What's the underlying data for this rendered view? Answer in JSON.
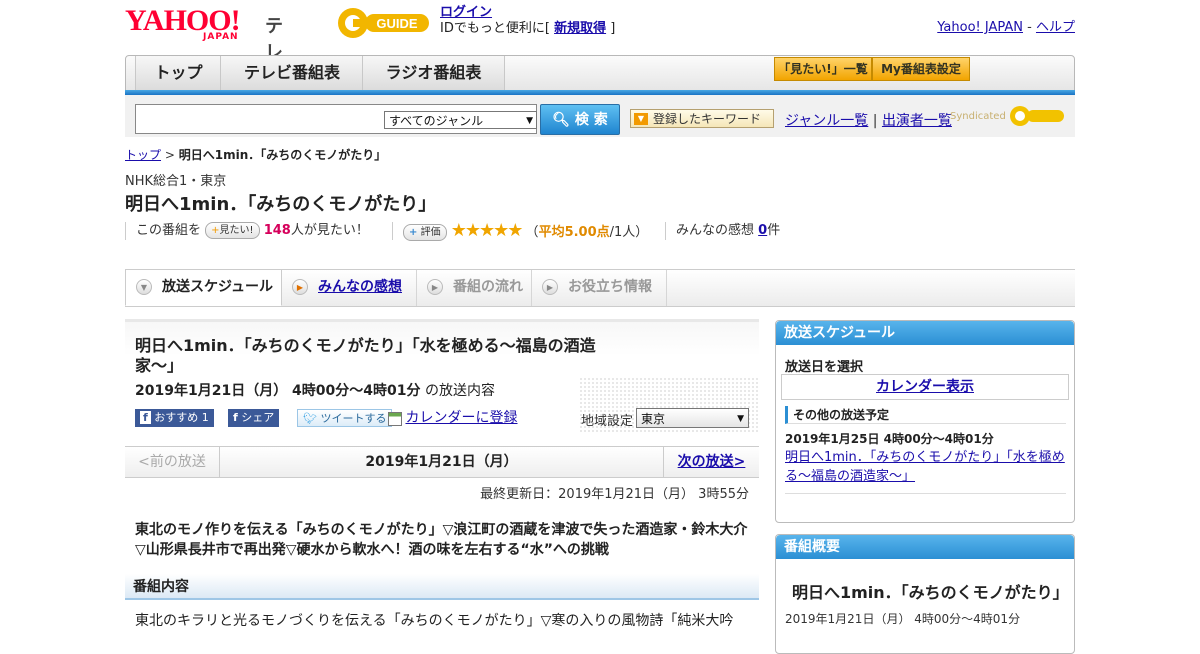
{
  "header": {
    "logo_yahoo": "YAHOO!",
    "logo_japan": "JAPAN",
    "logo_tv": "テレビ",
    "gguide": "G GUIDE",
    "login_link": "ログイン",
    "login_text": "IDでもっと便利に[",
    "signup_link": "新規取得",
    "login_close": "]",
    "yahoo_japan_link": "Yahoo! JAPAN",
    "separator": "-",
    "help_link": "ヘルプ"
  },
  "nav": {
    "tabs": [
      "トップ",
      "テレビ番組表",
      "ラジオ番組表"
    ],
    "mitai_list": "「見たい!」一覧",
    "my_settings": "My番組表設定"
  },
  "search": {
    "genre_selected": "すべてのジャンル",
    "search_button": "検 索",
    "keyword_button": "登録したキーワード",
    "genre_list": "ジャンル一覧",
    "divider": "|",
    "performer_list": "出演者一覧",
    "syndicated": "Syndicated"
  },
  "breadcrumb": {
    "top": "トップ",
    "separator": ">",
    "current": "明日へ1min．「みちのくモノがたり」"
  },
  "program": {
    "channel": "NHK総合1・東京",
    "title": "明日へ1min．「みちのくモノがたり」",
    "want_prefix": "この番組を",
    "want_button": "見たい!",
    "want_count": "148",
    "want_suffix": "人が見たい！",
    "rate_button": "評価",
    "stars": "★★★★★",
    "rating_open": "（",
    "rating_avg": "平均5.00点",
    "rating_count": "/1人）",
    "impressions_label": "みんなの感想",
    "impressions_count": "0",
    "impressions_unit": "件"
  },
  "tabs": [
    {
      "label": "放送スケジュール"
    },
    {
      "label": "みんなの感想"
    },
    {
      "label": "番組の流れ"
    },
    {
      "label": "お役立ち情報"
    }
  ],
  "episode": {
    "title": "明日へ1min．「みちのくモノがたり」「水を極める～福島の酒造家～」",
    "date_time": "2019年1月21日（月） 4時00分～4時01分",
    "date_suffix": "の放送内容",
    "share_fb_recommend": "おすすめ 1",
    "share_fb_share": "シェア",
    "share_tweet": "ツイートする",
    "calendar_register": "カレンダーに登録",
    "region_label": "地域設定",
    "region_selected": "東京",
    "prev": "<前の放送",
    "current_date": "2019年1月21日（月）",
    "next": "次の放送>",
    "updated": "最終更新日：2019年1月21日（月） 3時55分",
    "lead": "東北のモノ作りを伝える「みちのくモノがたり」▽浪江町の酒蔵を津波で失った酒造家・鈴木大介▽山形県長井市で再出発▽硬水から軟水へ！酒の味を左右する“水”への挑戦",
    "section_heading": "番組内容",
    "body": "東北のキラリと光るモノづくりを伝える「みちのくモノがたり」▽寒の入りの風物詩「純米大吟"
  },
  "sidebar": {
    "schedule_heading": "放送スケジュール",
    "select_date": "放送日を選択",
    "calendar_link": "カレンダー表示",
    "other_heading": "その他の放送予定",
    "other_date": "2019年1月25日 4時00分～4時01分",
    "other_link": "明日へ1min．「みちのくモノがたり」「水を極める～福島の酒造家～」",
    "overview_heading": "番組概要",
    "overview_title": "明日へ1min．「みちのくモノがたり」",
    "overview_date": "2019年1月21日（月） 4時00分～4時01分"
  }
}
